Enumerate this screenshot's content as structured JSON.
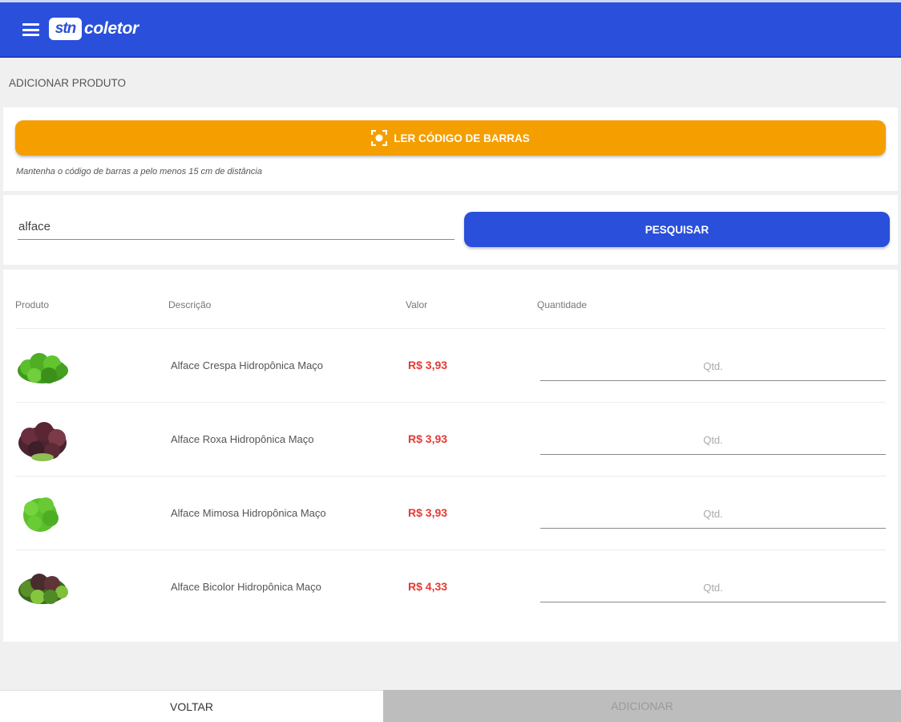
{
  "header": {
    "logo_box": "stn",
    "logo_text": "coletor",
    "color": "#2a4fdb"
  },
  "page_title": "ADICIONAR PRODUTO",
  "barcode": {
    "button_label": "LER CÓDIGO DE BARRAS",
    "icon": "scan-icon",
    "hint": "Mantenha o código de barras a pelo menos 15 cm de distância",
    "color": "#f59e00"
  },
  "search": {
    "value": "alface",
    "button_label": "PESQUISAR"
  },
  "table": {
    "headers": {
      "produto": "Produto",
      "descricao": "Descrição",
      "valor": "Valor",
      "quantidade": "Quantidade"
    },
    "rows": [
      {
        "description": "Alface Crespa Hidropônica Maço",
        "price": "R$ 3,93",
        "qty_placeholder": "Qtd.",
        "image": "lettuce-green-curly"
      },
      {
        "description": "Alface Roxa Hidropônica Maço",
        "price": "R$ 3,93",
        "qty_placeholder": "Qtd.",
        "image": "lettuce-purple"
      },
      {
        "description": "Alface Mimosa Hidropônica Maço",
        "price": "R$ 3,93",
        "qty_placeholder": "Qtd.",
        "image": "lettuce-mimosa"
      },
      {
        "description": "Alface Bicolor Hidropônica Maço",
        "price": "R$ 4,33",
        "qty_placeholder": "Qtd.",
        "image": "lettuce-bicolor"
      }
    ],
    "price_color": "#e53935"
  },
  "footer": {
    "back_label": "VOLTAR",
    "add_label": "ADICIONAR"
  }
}
